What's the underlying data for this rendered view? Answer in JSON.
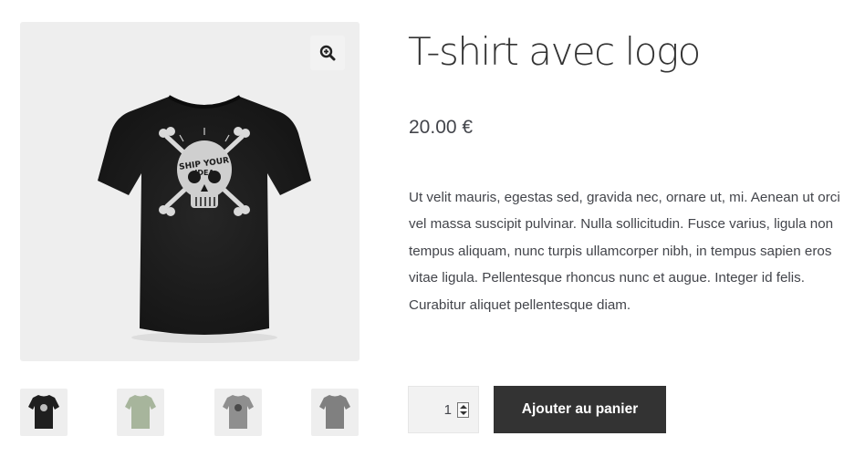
{
  "product": {
    "title": "T-shirt avec logo",
    "price": "20.00 €",
    "description": "Ut velit mauris, egestas sed, gravida nec, ornare ut, mi. Aenean ut orci vel massa suscipit pulvinar. Nulla sollicitudin. Fusce varius, ligula non tempus aliquam, nunc turpis ullamcorper nibh, in tempus sapien eros vitae ligula. Pellentesque rhoncus nunc et augue. Integer id felis. Curabitur aliquet pellentesque diam.",
    "quantity": "1",
    "add_to_cart_label": "Ajouter au panier"
  },
  "gallery": {
    "main_logo_text": "SHIP YOUR IDEA",
    "zoom_icon": "zoom-in-icon",
    "thumbnails": [
      {
        "color": "#1f1f1f"
      },
      {
        "color": "#a7b59c"
      },
      {
        "color": "#8f8f8f"
      },
      {
        "color": "#808080"
      }
    ]
  },
  "colors": {
    "button_bg": "#333333",
    "button_text": "#ffffff",
    "gallery_bg": "#eeeeee",
    "text": "#43454b"
  }
}
